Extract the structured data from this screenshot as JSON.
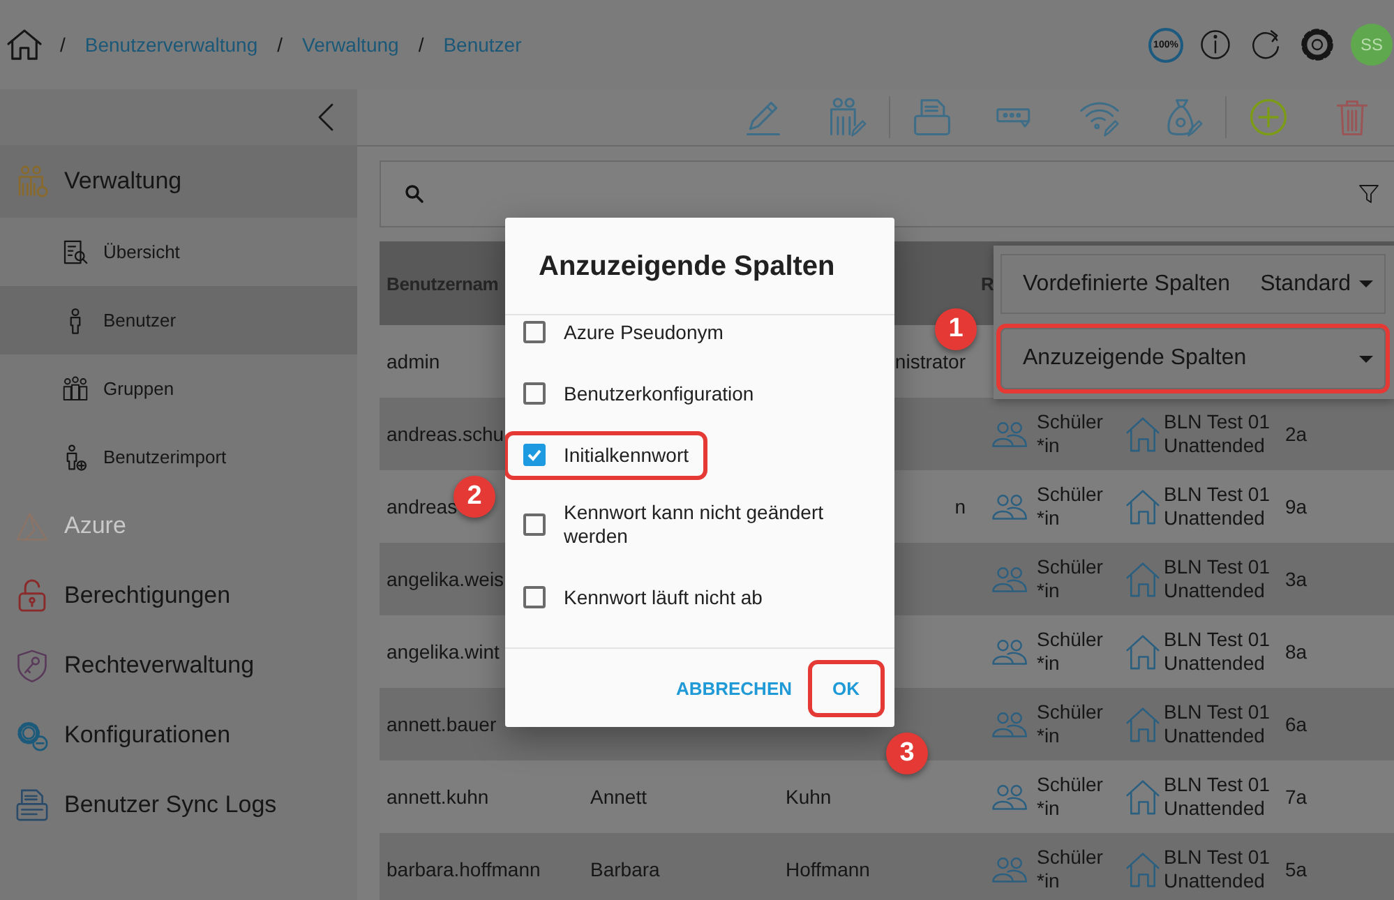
{
  "header": {
    "breadcrumb": [
      "Benutzerverwaltung",
      "Verwaltung",
      "Benutzer"
    ],
    "separator": "/",
    "zoom": "100%",
    "avatar": "SS"
  },
  "sidebar": {
    "items": [
      {
        "label": "Verwaltung",
        "disabled": false,
        "expanded": true,
        "children": [
          {
            "label": "Übersicht",
            "selected": false
          },
          {
            "label": "Benutzer",
            "selected": true
          },
          {
            "label": "Gruppen",
            "selected": false
          },
          {
            "label": "Benutzerimport",
            "selected": false
          }
        ]
      },
      {
        "label": "Azure",
        "disabled": true
      },
      {
        "label": "Berechtigungen",
        "disabled": false
      },
      {
        "label": "Rechteverwaltung",
        "disabled": false
      },
      {
        "label": "Konfigurationen",
        "disabled": false
      },
      {
        "label": "Benutzer Sync Logs",
        "disabled": false
      }
    ]
  },
  "table": {
    "columns": [
      "Benutzernam",
      "R"
    ],
    "rows": [
      {
        "username": "admin",
        "last_name": "nistrator",
        "last_name_cut": true
      },
      {
        "username": "andreas.schu",
        "role": "Schüler *in",
        "location": "BLN Test 01 Unattended",
        "class": "2a"
      },
      {
        "username": "andreas",
        "last_name": "n",
        "last_name_cut": true,
        "role": "Schüler *in",
        "location": "BLN Test 01 Unattended",
        "class": "9a"
      },
      {
        "username": "angelika.weis",
        "role": "Schüler *in",
        "location": "BLN Test 01 Unattended",
        "class": "3a"
      },
      {
        "username": "angelika.wint",
        "role": "Schüler *in",
        "location": "BLN Test 01 Unattended",
        "class": "8a"
      },
      {
        "username": "annett.bauer",
        "role": "Schüler *in",
        "location": "BLN Test 01 Unattended",
        "class": "6a"
      },
      {
        "username": "annett.kuhn",
        "first_name": "Annett",
        "last_name": "Kuhn",
        "last_name_cut": false,
        "role": "Schüler *in",
        "location": "BLN Test 01 Unattended",
        "class": "7a"
      },
      {
        "username": "barbara.hoffmann",
        "first_name": "Barbara",
        "last_name": "Hoffmann",
        "last_name_cut": false,
        "role": "Schüler *in",
        "location": "BLN Test 01 Unattended",
        "class": "5a"
      }
    ]
  },
  "column_menu": {
    "preset_label": "Vordefinierte Spalten",
    "preset_value": "Standard",
    "columns_select": {
      "label": "Anzuzeigende Spalten",
      "highlighted": true
    }
  },
  "dialog": {
    "title": "Anzuzeigende Spalten",
    "options": [
      {
        "label": "Azure Pseudonym",
        "checked": false,
        "highlighted": false
      },
      {
        "label": "Benutzerkonfiguration",
        "checked": false,
        "highlighted": false
      },
      {
        "label": "Initialkennwort",
        "checked": true,
        "highlighted": true
      },
      {
        "label": "Kennwort kann nicht geändert werden",
        "checked": false,
        "highlighted": false
      },
      {
        "label": "Kennwort läuft nicht ab",
        "checked": false,
        "highlighted": false
      }
    ],
    "buttons": [
      {
        "label": "ABBRECHEN",
        "highlighted": false
      },
      {
        "label": "OK",
        "highlighted": true
      }
    ]
  },
  "annotations": [
    {
      "number": "1"
    },
    {
      "number": "2"
    },
    {
      "number": "3"
    }
  ]
}
